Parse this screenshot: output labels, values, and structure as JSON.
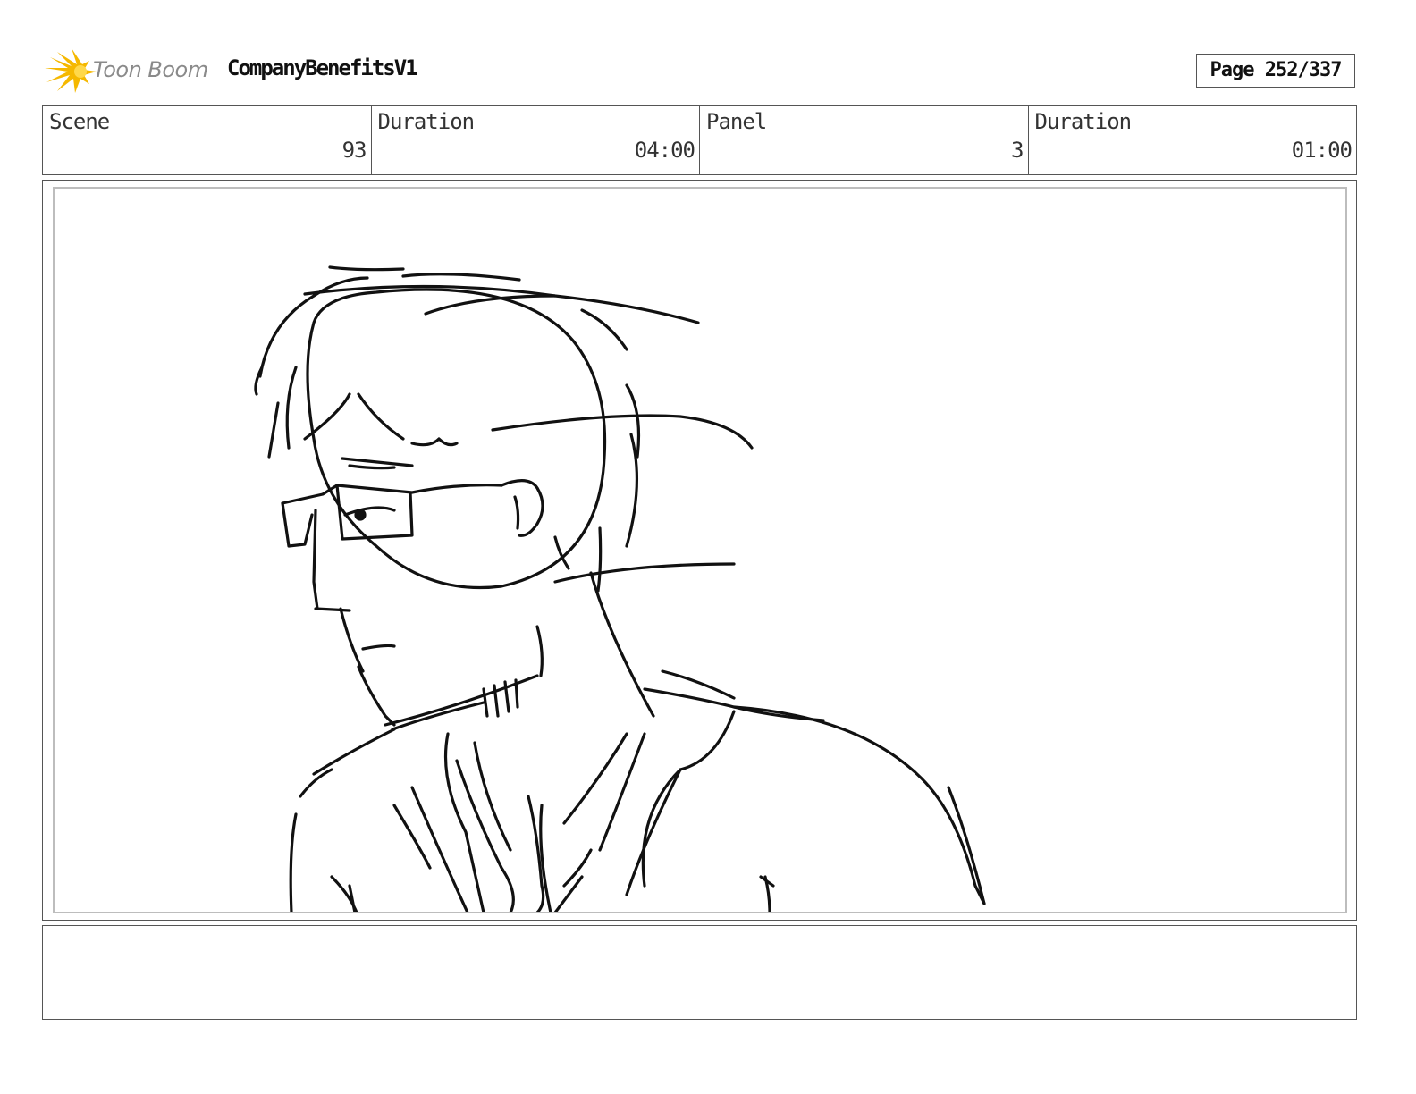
{
  "header": {
    "logo_text": "Toon Boom",
    "project_title": "CompanyBenefitsV1",
    "page_label": "Page 252/337"
  },
  "info": {
    "scene_label": "Scene",
    "scene_value": "93",
    "scene_duration_label": "Duration",
    "scene_duration_value": "04:00",
    "panel_label": "Panel",
    "panel_value": "3",
    "panel_duration_label": "Duration",
    "panel_duration_value": "01:00"
  },
  "notes": {
    "text": ""
  },
  "colors": {
    "logo_star": "#f5b800",
    "border": "#555555",
    "inner_border": "#bdbdbd"
  }
}
